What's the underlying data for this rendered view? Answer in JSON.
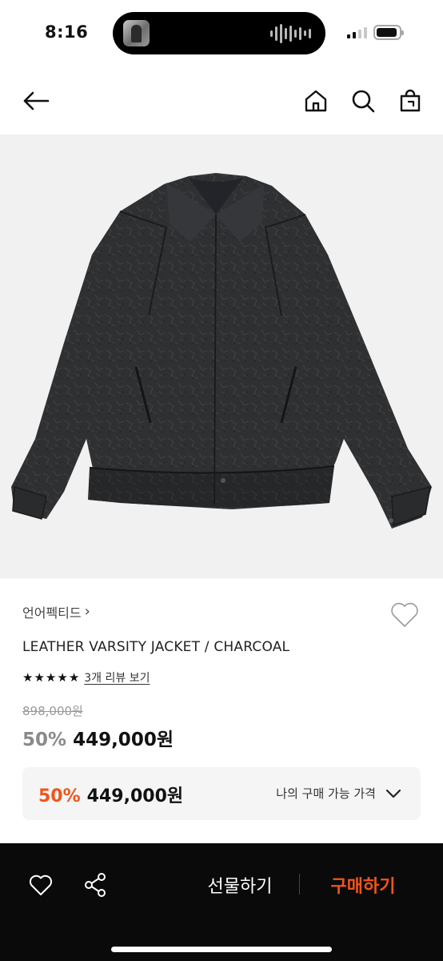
{
  "status_bar": {
    "time": "8:16"
  },
  "nav": {
    "back_icon": "arrow-left-icon",
    "home_icon": "home-icon",
    "search_icon": "search-icon",
    "bag_icon": "shopping-bag-icon"
  },
  "product": {
    "brand": "언어펙티드",
    "brand_chevron": "›",
    "name": "LEATHER VARSITY JACKET / CHARCOAL",
    "rating_stars": 5,
    "review_link": "3개 리뷰 보기",
    "original_price": "898,000원",
    "discount": "50%",
    "price": "449,000원"
  },
  "my_price": {
    "discount": "50%",
    "price": "449,000원",
    "label": "나의 구매 가능 가격"
  },
  "bottom_bar": {
    "gift_label": "선물하기",
    "buy_label": "구매하기"
  },
  "colors": {
    "accent": "#f2541b",
    "bottom_bar_bg": "#0a0a0a",
    "price_box_bg": "#f5f5f5",
    "image_bg": "#f1f1f1"
  }
}
